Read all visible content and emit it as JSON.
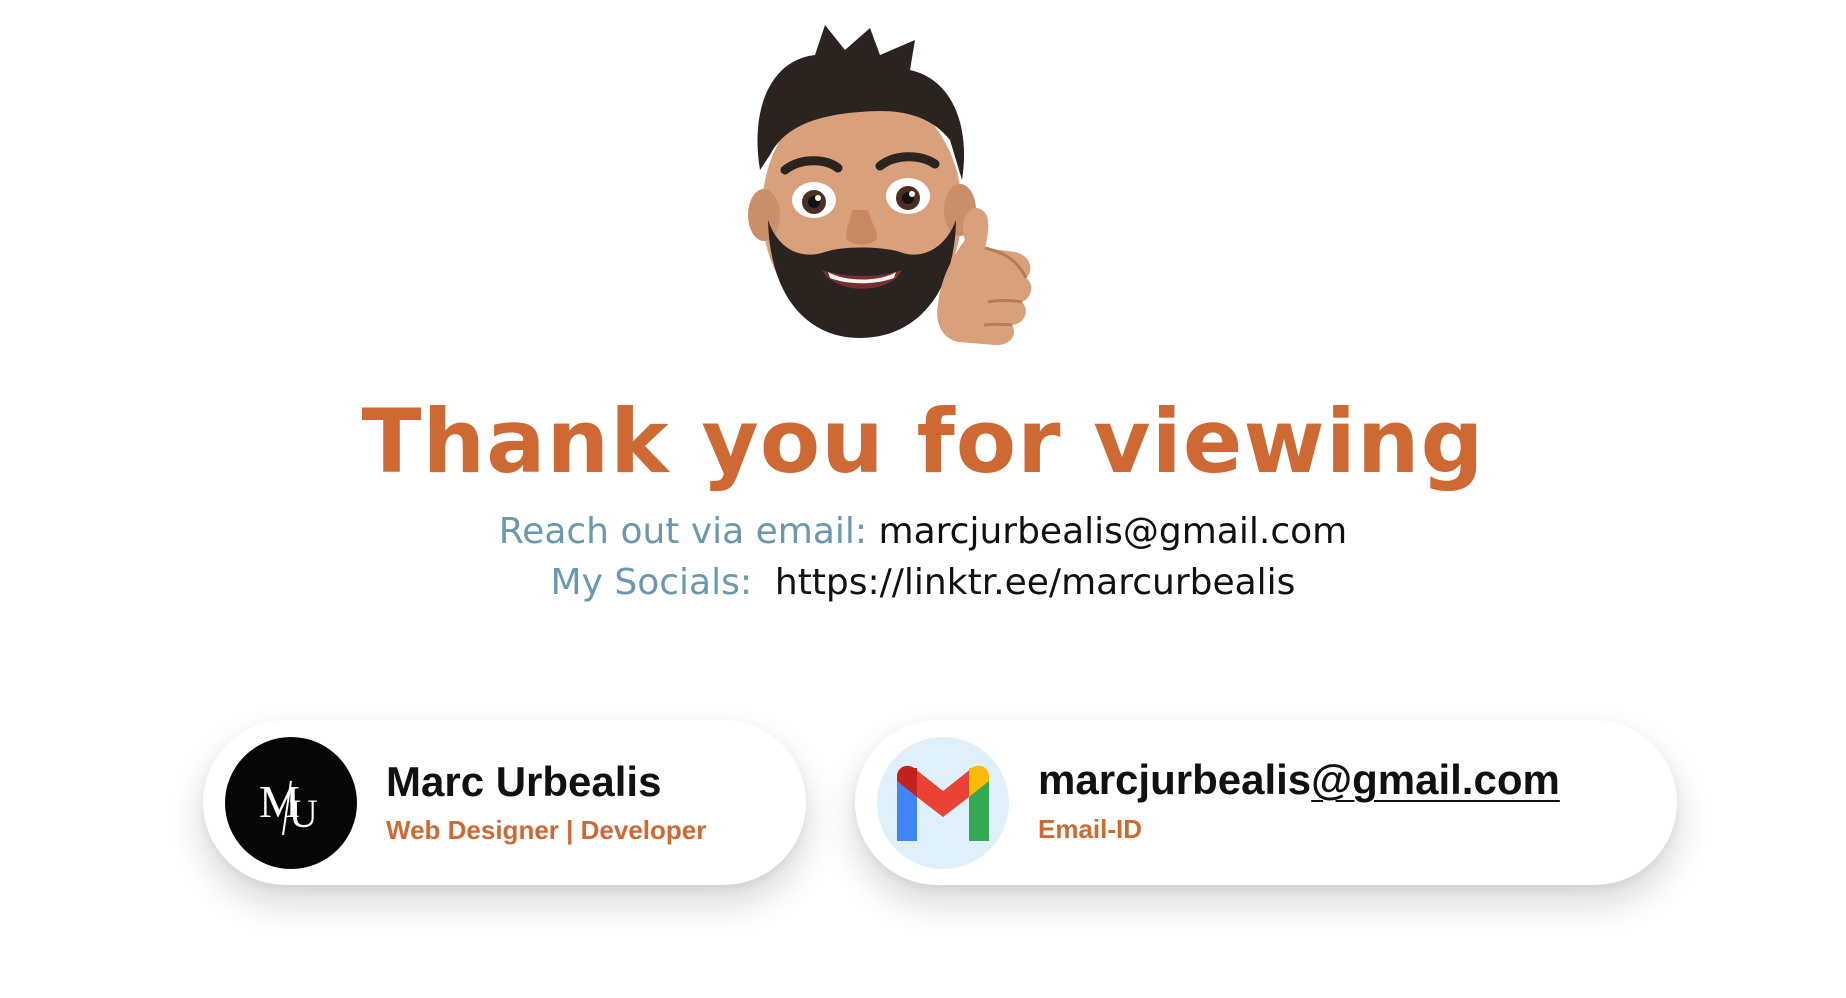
{
  "header": {
    "avatar_icon": "memoji-thumbs-up-icon",
    "title": "Thank you for viewing"
  },
  "contact": {
    "email_label": "Reach out via email:",
    "email_value": "marcjurbealis@gmail.com",
    "socials_label": "My Socials:",
    "socials_value": "https://linktr.ee/marcurbealis"
  },
  "cards": {
    "profile": {
      "logo_icon": "mu-logo-icon",
      "name": "Marc Urbealis",
      "role": "Web Designer | Developer"
    },
    "email": {
      "icon": "gmail-icon",
      "address_user": "marcjurbealis",
      "address_domain": "@gmail.com",
      "label": "Email-ID"
    }
  },
  "colors": {
    "accent": "#cf6934",
    "label_blue": "#6b98ad",
    "text_dark": "#111111"
  }
}
